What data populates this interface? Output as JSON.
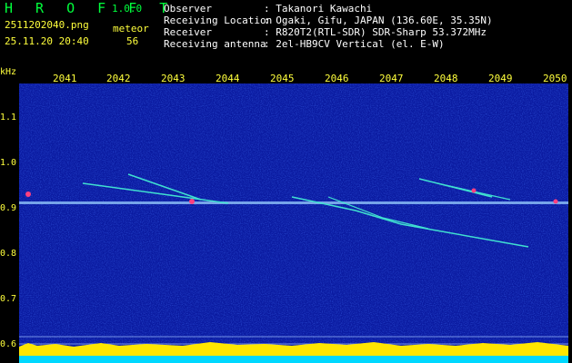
{
  "header": {
    "app_title": "H R O F F T",
    "version": "1.0.0",
    "file_name": "2511202040.png",
    "date_time": "25.11.20 20:40",
    "meteor_label": "meteor",
    "meteor_count": "56"
  },
  "info": [
    {
      "label": "Observer",
      "value": ": Takanori Kawachi"
    },
    {
      "label": "Receiving Location",
      "value": ": Ogaki, Gifu, JAPAN (136.60E, 35.35N)"
    },
    {
      "label": "Receiver",
      "value": ": R820T2(RTL-SDR) SDR-Sharp 53.372MHz"
    },
    {
      "label": "Receiving antenna",
      "value": ": 2el-HB9CV Vertical (el. E-W)"
    }
  ],
  "axis": {
    "y_unit": "kHz",
    "y_ticks": [
      "1.1",
      "1.0",
      "0.9",
      "0.8",
      "0.7",
      "0.6"
    ],
    "x_ticks": [
      "2041",
      "2042",
      "2043",
      "2044",
      "2045",
      "2046",
      "2047",
      "2048",
      "2049",
      "2050"
    ]
  },
  "colors": {
    "background": "#0a1aa0",
    "title": "#00ff3c",
    "labels": "#ffff3c",
    "trail": "#40e0d0",
    "bottom_band": "#ffe600",
    "baseline": "#00d8ff"
  }
}
